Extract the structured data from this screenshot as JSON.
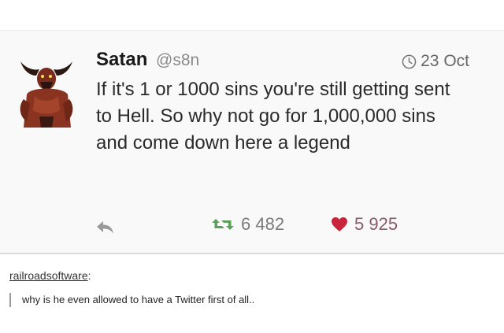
{
  "tweet": {
    "author_name": "Satan",
    "author_handle": "@s8n",
    "time": "23 Oct",
    "text": "If it's 1 or 1000 sins you're still getting sent to Hell. So why not go for 1,000,000 sins and come down here a legend",
    "retweet_count": "6 482",
    "like_count": "5 925",
    "icons": {
      "time": "clock-icon",
      "reply": "reply-icon",
      "retweet": "retweet-icon",
      "like": "heart-icon"
    },
    "colors": {
      "retweet_icon": "#5aa05a",
      "heart_icon": "#c8243c"
    }
  },
  "comment": {
    "username": "railroadsoftware",
    "text": "why is he even allowed to have a Twitter first of all.."
  }
}
